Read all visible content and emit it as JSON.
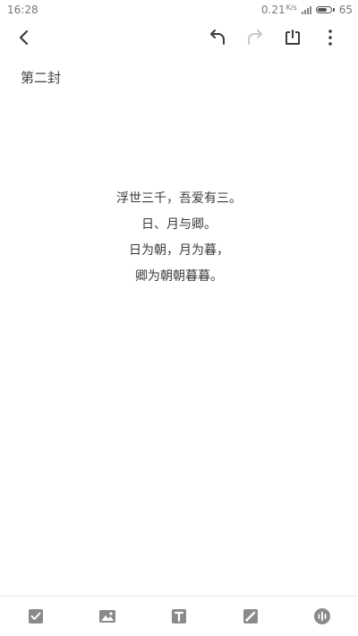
{
  "status_bar": {
    "time": "16:28",
    "net_speed": "0.21",
    "net_speed_unit": "K/s",
    "battery_level": "65",
    "battery_fraction": 0.65
  },
  "toolbar": {
    "back_icon": "chevron-left-icon",
    "undo_icon": "undo-icon",
    "redo_icon": "redo-icon",
    "redo_enabled": false,
    "reminder_icon": "alarm-icon",
    "more_icon": "more-vertical-icon"
  },
  "note": {
    "title": "第二封",
    "lines": [
      "浮世三千，吾爱有三。",
      "日、月与卿。",
      "日为朝，月为暮，",
      "卿为朝朝暮暮。"
    ]
  },
  "bottom_bar": {
    "icons": [
      "checkbox-icon",
      "image-icon",
      "text-format-icon",
      "brush-icon",
      "voice-icon"
    ]
  },
  "colors": {
    "icon_dark": "#3c3c3c",
    "icon_disabled": "#c8c8c8",
    "bottom_icon": "#8a8a8a",
    "text": "#333333"
  }
}
